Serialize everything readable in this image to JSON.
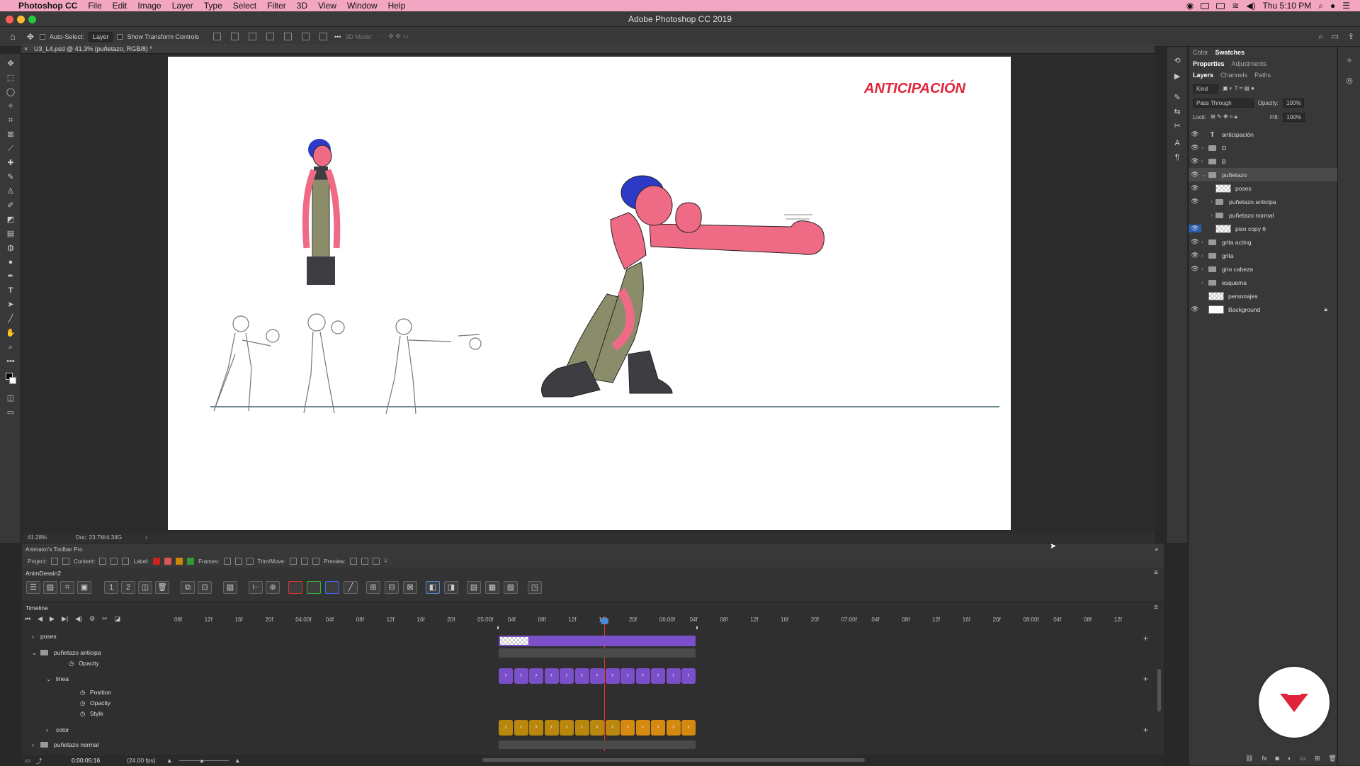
{
  "menubar": {
    "app": "Photoshop CC",
    "items": [
      "File",
      "Edit",
      "Image",
      "Layer",
      "Type",
      "Select",
      "Filter",
      "3D",
      "View",
      "Window",
      "Help"
    ],
    "clock": "Thu 5:10 PM"
  },
  "window": {
    "title": "Adobe Photoshop CC 2019"
  },
  "options": {
    "auto_select": "Auto-Select:",
    "auto_select_value": "Layer",
    "show_transform": "Show Transform Controls",
    "mode_3d": "3D Mode:"
  },
  "document": {
    "tab": "U3_L4.psd @ 41.3% (puñetazo, RGB/8) *"
  },
  "artboard": {
    "heading": "ANTICIPACIÓN"
  },
  "status": {
    "zoom": "41.28%",
    "doc": "Doc: 23.7M/4.34G"
  },
  "panel": {
    "top_tabs": [
      "Color",
      "Swatches"
    ],
    "mid_tabs": [
      "Properties",
      "Adjustments"
    ],
    "layer_tabs": [
      "Layers",
      "Channels",
      "Paths"
    ],
    "kind": "Kind",
    "blend": "Pass Through",
    "opacity_label": "Opacity:",
    "opacity": "100%",
    "lock_label": "Lock:",
    "fill_label": "Fill:",
    "fill": "100%",
    "layers": [
      {
        "name": "anticipación",
        "kind": "text",
        "visible": true
      },
      {
        "name": "D",
        "kind": "folder",
        "visible": true
      },
      {
        "name": "B",
        "kind": "folder",
        "visible": true
      },
      {
        "name": "puñetazo",
        "kind": "folder",
        "visible": true,
        "selected": true,
        "open": true
      },
      {
        "name": "poses",
        "kind": "pixel",
        "visible": true
      },
      {
        "name": "puñetazo anticipa",
        "kind": "folder",
        "visible": true
      },
      {
        "name": "puñetazo normal",
        "kind": "folder",
        "visible": false
      },
      {
        "name": "piso copy 6",
        "kind": "pixel",
        "visible": true
      },
      {
        "name": "grita acting",
        "kind": "folder",
        "visible": true
      },
      {
        "name": "grita",
        "kind": "folder",
        "visible": true
      },
      {
        "name": "giro cabeza",
        "kind": "folder",
        "visible": true
      },
      {
        "name": "esquema",
        "kind": "folder",
        "visible": false
      },
      {
        "name": "personajes",
        "kind": "pixel",
        "visible": false
      },
      {
        "name": "Background",
        "kind": "white",
        "visible": true,
        "locked": true
      }
    ]
  },
  "animator": {
    "title": "Animator's Toolbar Pro",
    "project": "Project:",
    "content": "Content:",
    "label": "Label:",
    "frames": "Frames:",
    "trim": "Trim/Move:",
    "preview": "Preview:"
  },
  "animdessin": {
    "title": "AnimDessin2"
  },
  "timeline": {
    "title": "Timeline",
    "ruler": [
      "08f",
      "12f",
      "16f",
      "20f",
      "04:00f",
      "04f",
      "08f",
      "12f",
      "16f",
      "20f",
      "05:00f",
      "04f",
      "08f",
      "12f",
      "16f",
      "20f",
      "06:00f",
      "04f",
      "08f",
      "12f",
      "16f",
      "20f",
      "07:00f",
      "04f",
      "08f",
      "12f",
      "16f",
      "20f",
      "08:00f",
      "04f",
      "08f",
      "12f"
    ],
    "rows": [
      "poses",
      "puñetazo anticipa",
      "Opacity",
      "linea",
      "Position",
      "Opacity",
      "Style",
      "color",
      "puñetazo normal"
    ],
    "timecode": "0:00:05:16",
    "fps": "(24.00 fps)"
  },
  "colors": {
    "menubar": "#f2a6c1",
    "purple": "#7a4fc9",
    "orange": "#d48a10",
    "accent_red": "#e0243a"
  }
}
